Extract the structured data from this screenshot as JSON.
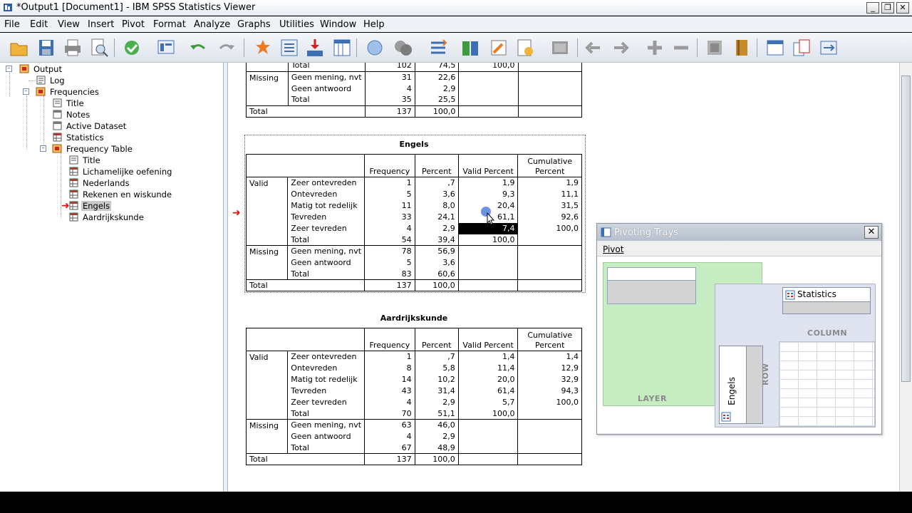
{
  "window": {
    "title": "*Output1 [Document1] - IBM SPSS Statistics Viewer",
    "controls": [
      "minimize",
      "restore",
      "close"
    ]
  },
  "menubar": [
    "File",
    "Edit",
    "View",
    "Insert",
    "Pivot",
    "Format",
    "Analyze",
    "Graphs",
    "Utilities",
    "Window",
    "Help"
  ],
  "toolbar": {
    "icons": [
      "open-icon",
      "save-icon",
      "print-icon",
      "print-preview-icon",
      "export-icon",
      "recall-dialog-icon",
      "undo-icon",
      "redo-icon",
      "goto-data-icon",
      "goto-case-icon",
      "goto-variable-icon",
      "variables-icon",
      "designate-window-icon",
      "select-cases-icon",
      "weight-cases-icon",
      "split-file-icon",
      "pivot-table-icon",
      "create-title-icon",
      "create-text-icon",
      "script-icon",
      "hide-icon",
      "promote-icon",
      "demote-icon",
      "expand-icon",
      "collapse-icon",
      "show-icon",
      "book-icon",
      "insert-heading-icon",
      "insert-table-icon",
      "insert-chart-icon"
    ]
  },
  "outline": {
    "root": "Output",
    "log": "Log",
    "frequencies": "Frequencies",
    "title": "Title",
    "notes": "Notes",
    "active_dataset": "Active Dataset",
    "statistics": "Statistics",
    "frequency_table": "Frequency Table",
    "ft_title": "Title",
    "items": [
      "Lichamelijke oefening",
      "Nederlands",
      "Rekenen en wiskunde",
      "Engels",
      "Aardrijkskunde"
    ],
    "selected": "Engels"
  },
  "tables": {
    "partial": {
      "rows": [
        [
          "",
          "Total",
          "102",
          "74,5",
          "100,0",
          ""
        ],
        [
          "Missing",
          "Geen mening, nvt",
          "31",
          "22,6",
          "",
          ""
        ],
        [
          "",
          "Geen antwoord",
          "4",
          "2,9",
          "",
          ""
        ],
        [
          "",
          "Total",
          "35",
          "25,5",
          "",
          ""
        ],
        [
          "Total",
          "",
          "137",
          "100,0",
          "",
          ""
        ]
      ]
    },
    "headers": [
      "Frequency",
      "Percent",
      "Valid Percent",
      "Cumulative Percent"
    ],
    "engels": {
      "title": "Engels",
      "valid_label": "Valid",
      "valid_rows": [
        [
          "Zeer ontevreden",
          "1",
          ",7",
          "1,9",
          "1,9"
        ],
        [
          "Ontevreden",
          "5",
          "3,6",
          "9,3",
          "11,1"
        ],
        [
          "Matig tot redelijk",
          "11",
          "8,0",
          "20,4",
          "31,5"
        ],
        [
          "Tevreden",
          "33",
          "24,1",
          "61,1",
          "92,6"
        ],
        [
          "Zeer tevreden",
          "4",
          "2,9",
          "7,4",
          "100,0"
        ],
        [
          "Total",
          "54",
          "39,4",
          "100,0",
          ""
        ]
      ],
      "missing_label": "Missing",
      "missing_rows": [
        [
          "Geen mening, nvt",
          "78",
          "56,9",
          "",
          ""
        ],
        [
          "Geen antwoord",
          "5",
          "3,6",
          "",
          ""
        ],
        [
          "Total",
          "83",
          "60,6",
          "",
          ""
        ]
      ],
      "total_row": [
        "Total",
        "137",
        "100,0",
        "",
        ""
      ]
    },
    "aardrijkskunde": {
      "title": "Aardrijkskunde",
      "valid_label": "Valid",
      "valid_rows": [
        [
          "Zeer ontevreden",
          "1",
          ",7",
          "1,4",
          "1,4"
        ],
        [
          "Ontevreden",
          "8",
          "5,8",
          "11,4",
          "12,9"
        ],
        [
          "Matig tot redelijk",
          "14",
          "10,2",
          "20,0",
          "32,9"
        ],
        [
          "Tevreden",
          "43",
          "31,4",
          "61,4",
          "94,3"
        ],
        [
          "Zeer tevreden",
          "4",
          "2,9",
          "5,7",
          "100,0"
        ],
        [
          "Total",
          "70",
          "51,1",
          "100,0",
          ""
        ]
      ],
      "missing_label": "Missing",
      "missing_rows": [
        [
          "Geen mening, nvt",
          "63",
          "46,0",
          "",
          ""
        ],
        [
          "Geen antwoord",
          "4",
          "2,9",
          "",
          ""
        ],
        [
          "Total",
          "67",
          "48,9",
          "",
          ""
        ]
      ],
      "total_row": [
        "Total",
        "137",
        "100,0",
        "",
        ""
      ]
    }
  },
  "pivoting_trays": {
    "title": "Pivoting Trays",
    "menu": "Pivot",
    "layer_label": "LAYER",
    "column_label": "COLUMN",
    "row_label": "ROW",
    "column_item": "Statistics",
    "row_item": "Engels"
  },
  "colors": {
    "layer_bg": "#c6ecc2",
    "selection": "#000000",
    "arrow": "#e01010"
  }
}
